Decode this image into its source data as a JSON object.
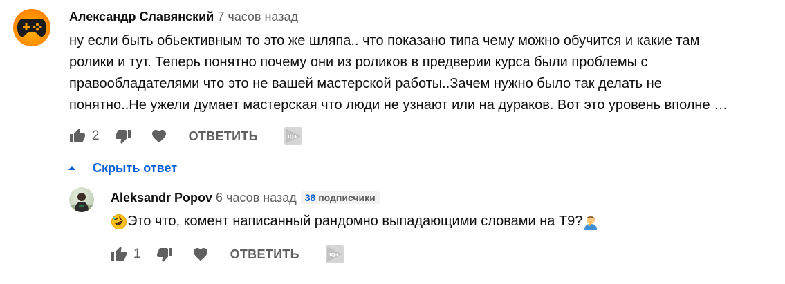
{
  "comment": {
    "author": "Александр Славянский",
    "time": "7 часов назад",
    "avatar_icon": "gamepad-icon",
    "text_lines": [
      "ну если быть обьективным то это же шляпа.. что показано типа чему можно обучится и какие там",
      "ролики и тут. Теперь понятно почему они из роликов в предверии курса были проблемы с",
      "правообладателями что это не вашей мастерской работы..Зачем нужно было так делать не",
      "понятно..Не ужели думает мастерская что люди не узнают или на дураков. Вот это уровень вполне …"
    ],
    "likes": "2",
    "reply_label": "ОТВЕТИТЬ"
  },
  "replies_toggle": {
    "label": "Скрыть ответ",
    "icon": "caret-up-icon"
  },
  "reply": {
    "author": "Aleksandr Popov",
    "time": "6 часов назад",
    "subscribers_count": "38",
    "subscribers_label": "подписчики",
    "emoji_start": "rolling-on-floor-laughing-emoji",
    "text": "Это что, комент написанный рандомно выпадающими словами на Т9?",
    "emoji_end": "person-facepalming-emoji",
    "likes": "1",
    "reply_label": "ОТВЕТИТЬ"
  },
  "colors": {
    "link_blue": "#065fd4",
    "secondary_text": "#606060",
    "primary_text": "#0f0f0f",
    "avatar_orange": "#ff9100"
  }
}
